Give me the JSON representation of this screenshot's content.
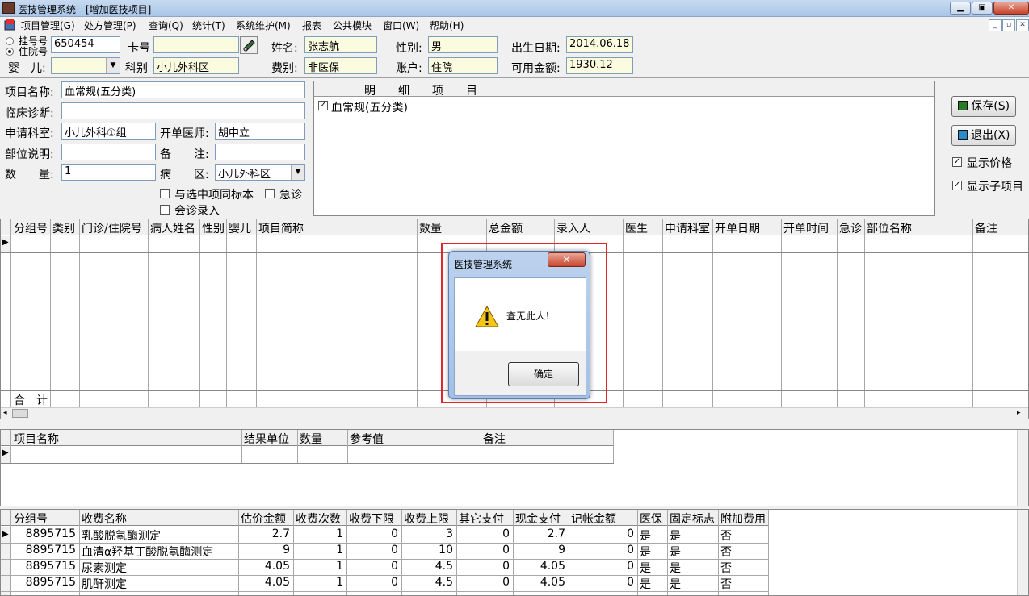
{
  "window": {
    "title": "医技管理系统 - [增加医技项目]",
    "min_icon": "minimize-icon",
    "max_icon": "maximize-icon",
    "close_icon": "close-icon"
  },
  "menu": [
    "项目管理(G)",
    "处方管理(P)",
    "查询(Q)",
    "统计(T)",
    "系统维护(M)",
    "报表",
    "公共模块",
    "窗口(W)",
    "帮助(H)"
  ],
  "patient": {
    "reg_label": "挂号号",
    "inpatient_label": "住院号",
    "id_value": "650454",
    "card_label": "卡号",
    "card_value": "",
    "name_label": "姓名:",
    "name_value": "张志航",
    "gender_label": "性别:",
    "gender_value": "男",
    "dob_label": "出生日期:",
    "dob_value": "2014.06.18",
    "infant_label": "婴　儿:",
    "infant_value": "",
    "dept_label": "科别",
    "dept_value": "小儿外科区",
    "fee_type_label": "费别:",
    "fee_type_value": "非医保",
    "account_label": "账户:",
    "account_value": "住院",
    "balance_label": "可用金额:",
    "balance_value": "1930.12"
  },
  "form": {
    "item_name_label": "项目名称:",
    "item_name_value": "血常规(五分类)",
    "diagnosis_label": "临床诊断:",
    "diagnosis_value": "",
    "req_dept_label": "申请科室:",
    "req_dept_value": "小儿外科①组",
    "doctor_label": "开单医师:",
    "doctor_value": "胡中立",
    "site_label": "部位说明:",
    "site_value": "",
    "remark_label": "备　　注:",
    "remark_value": "",
    "qty_label": "数　　量:",
    "qty_value": "1",
    "ward_label": "病　　区:",
    "ward_value": "小儿外科区",
    "same_sample_label": "与选中项同标本",
    "urgent_label": "急诊",
    "consult_label": "会诊录入"
  },
  "detail_panel": {
    "header": "明　　细　　项　　目",
    "items": [
      {
        "label": "血常规(五分类)",
        "checked": true
      }
    ]
  },
  "side": {
    "save_label": "保存(S)",
    "exit_label": "退出(X)",
    "show_price_label": "显示价格",
    "show_sub_label": "显示子项目"
  },
  "main_grid": {
    "columns": [
      "分组号",
      "类别",
      "门诊/住院号",
      "病人姓名",
      "性别",
      "婴儿",
      "项目简称",
      "数量",
      "总金额",
      "录入人",
      "医生",
      "申请科室",
      "开单日期",
      "开单时间",
      "急诊",
      "部位名称",
      "备注"
    ],
    "total_label": "合　计"
  },
  "result_grid": {
    "columns": [
      "项目名称",
      "结果单位",
      "数量",
      "参考值",
      "备注"
    ]
  },
  "fee_grid": {
    "columns": [
      "分组号",
      "收费名称",
      "估价金额",
      "收费次数",
      "收费下限",
      "收费上限",
      "其它支付",
      "现金支付",
      "记帐金额",
      "医保",
      "固定标志",
      "附加费用"
    ],
    "rows": [
      [
        "8895715",
        "乳酸脱氢酶测定",
        "2.7",
        "1",
        "0",
        "3",
        "0",
        "2.7",
        "0",
        "是",
        "是",
        "否"
      ],
      [
        "8895715",
        "血清α羟基丁酸脱氢酶测定",
        "9",
        "1",
        "0",
        "10",
        "0",
        "9",
        "0",
        "是",
        "是",
        "否"
      ],
      [
        "8895715",
        "尿素测定",
        "4.05",
        "1",
        "0",
        "4.5",
        "0",
        "4.05",
        "0",
        "是",
        "是",
        "否"
      ],
      [
        "8895715",
        "肌酐测定",
        "4.05",
        "1",
        "0",
        "4.5",
        "0",
        "4.05",
        "0",
        "是",
        "是",
        "否"
      ]
    ]
  },
  "dialog": {
    "title": "医技管理系统",
    "message": "查无此人！",
    "ok_label": "确定",
    "icon": "warning-icon"
  },
  "colors": {
    "highlight_border": "#e2262a",
    "title_bar": "#b8d0ec",
    "readonly_field": "#fbfbe0"
  }
}
